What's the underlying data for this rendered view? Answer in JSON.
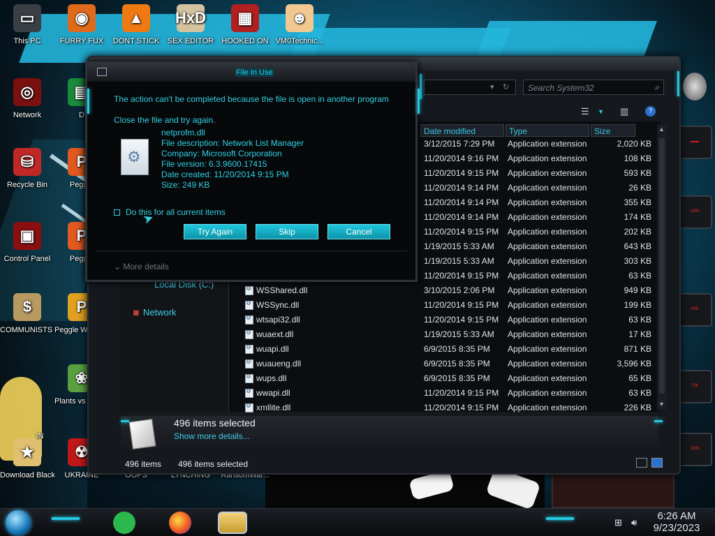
{
  "desktop": {
    "icons": [
      {
        "label": "This PC",
        "glyph": "▭",
        "color": "#3a3f46"
      },
      {
        "label": "FURRY FUX",
        "glyph": "◉",
        "color": "#e06a1b"
      },
      {
        "label": "DONT STICK",
        "glyph": "▲",
        "color": "#f07a12"
      },
      {
        "label": "SEX EDITOR",
        "glyph": "HxD",
        "color": "#d5c3a0"
      },
      {
        "label": "HOOKED ON",
        "glyph": "▦",
        "color": "#b02020"
      },
      {
        "label": "VM0Technic...",
        "glyph": "☻",
        "color": "#f0c890"
      },
      {
        "label": "Network",
        "glyph": "◎",
        "color": "#7a1010"
      },
      {
        "label": "D",
        "glyph": "▤",
        "color": "#1b8a3a"
      },
      {
        "label": "Recycle Bin",
        "glyph": "⛁",
        "color": "#c02828"
      },
      {
        "label": "Peggle",
        "glyph": "P",
        "color": "#e05a20"
      },
      {
        "label": "Control Panel",
        "glyph": "▣",
        "color": "#8a1010"
      },
      {
        "label": "Peggle",
        "glyph": "P",
        "color": "#e05a20"
      },
      {
        "label": "COMMUNISTS HATE THIS G...",
        "glyph": "$",
        "color": "#b89a60"
      },
      {
        "label": "Peggle World of Warcraft ...",
        "glyph": "P",
        "color": "#e0a020"
      },
      {
        "label": "Plants vs Zombies",
        "glyph": "❀",
        "color": "#5aa040"
      },
      {
        "label": "Download Black Ali...",
        "glyph": "★",
        "color": "#e0c070"
      },
      {
        "label": "UKRAINE",
        "glyph": "☢",
        "color": "#c01818"
      },
      {
        "label": "OOPS",
        "glyph": "",
        "color": "transparent"
      },
      {
        "label": "LYNCHING",
        "glyph": "",
        "color": "transparent"
      },
      {
        "label": "RansomWar...",
        "glyph": "",
        "color": "transparent"
      },
      {
        "label": "IN",
        "glyph": "",
        "color": "transparent"
      }
    ]
  },
  "explorer": {
    "search_placeholder": "Search System32",
    "columns": [
      "Date modified",
      "Type",
      "Size"
    ],
    "nav": {
      "disk": "Local Disk (C:)",
      "network": "Network"
    },
    "rows": [
      {
        "name": "",
        "date": "3/12/2015 7:29 PM",
        "type": "Application extension",
        "size": "2,020 KB"
      },
      {
        "name": "",
        "date": "11/20/2014 9:16 PM",
        "type": "Application extension",
        "size": "108 KB"
      },
      {
        "name": "",
        "date": "11/20/2014 9:15 PM",
        "type": "Application extension",
        "size": "593 KB"
      },
      {
        "name": "",
        "date": "11/20/2014 9:14 PM",
        "type": "Application extension",
        "size": "26 KB"
      },
      {
        "name": "",
        "date": "11/20/2014 9:14 PM",
        "type": "Application extension",
        "size": "355 KB"
      },
      {
        "name": "",
        "date": "11/20/2014 9:14 PM",
        "type": "Application extension",
        "size": "174 KB"
      },
      {
        "name": "",
        "date": "11/20/2014 9:15 PM",
        "type": "Application extension",
        "size": "202 KB"
      },
      {
        "name": "",
        "date": "1/19/2015 5:33 AM",
        "type": "Application extension",
        "size": "643 KB"
      },
      {
        "name": "",
        "date": "1/19/2015 5:33 AM",
        "type": "Application extension",
        "size": "303 KB"
      },
      {
        "name": "",
        "date": "11/20/2014 9:15 PM",
        "type": "Application extension",
        "size": "63 KB"
      },
      {
        "name": "WSShared.dll",
        "date": "3/10/2015 2:06 PM",
        "type": "Application extension",
        "size": "949 KB"
      },
      {
        "name": "WSSync.dll",
        "date": "11/20/2014 9:15 PM",
        "type": "Application extension",
        "size": "199 KB"
      },
      {
        "name": "wtsapi32.dll",
        "date": "11/20/2014 9:15 PM",
        "type": "Application extension",
        "size": "63 KB"
      },
      {
        "name": "wuaext.dll",
        "date": "1/19/2015 5:33 AM",
        "type": "Application extension",
        "size": "17 KB"
      },
      {
        "name": "wuapi.dll",
        "date": "6/9/2015 8:35 PM",
        "type": "Application extension",
        "size": "871 KB"
      },
      {
        "name": "wuaueng.dll",
        "date": "6/9/2015 8:35 PM",
        "type": "Application extension",
        "size": "3,596 KB"
      },
      {
        "name": "wups.dll",
        "date": "6/9/2015 8:35 PM",
        "type": "Application extension",
        "size": "65 KB"
      },
      {
        "name": "wwapi.dll",
        "date": "11/20/2014 9:15 PM",
        "type": "Application extension",
        "size": "63 KB"
      },
      {
        "name": "xmllite.dll",
        "date": "11/20/2014 9:15 PM",
        "type": "Application extension",
        "size": "226 KB"
      }
    ],
    "details": {
      "selected": "496 items selected",
      "more": "Show more details..."
    },
    "status": {
      "count": "496 items",
      "selected": "496 items selected"
    }
  },
  "dialog": {
    "title": "File In Use",
    "message": "The action can't be completed because the file is open in another program",
    "sub": "Close the file and try again.",
    "file": {
      "name": "netprofm.dll",
      "description": "File description: Network List Manager",
      "company": "Company: Microsoft Corporation",
      "version": "File version: 6.3.9600.17415",
      "created": "Date created: 11/20/2014 9:15 PM",
      "size": "Size: 249 KB"
    },
    "checkbox": "Do this for all current items",
    "buttons": {
      "retry": "Try Again",
      "skip": "Skip",
      "cancel": "Cancel"
    },
    "more_details": "More details"
  },
  "taskbar": {
    "time": "6:26 AM",
    "date": "9/23/2023",
    "apps": [
      "green-chat-icon",
      "firefox-icon",
      "file-explorer-icon"
    ]
  },
  "colors": {
    "accent": "#2fd1e6",
    "button": "#18b6cc"
  }
}
